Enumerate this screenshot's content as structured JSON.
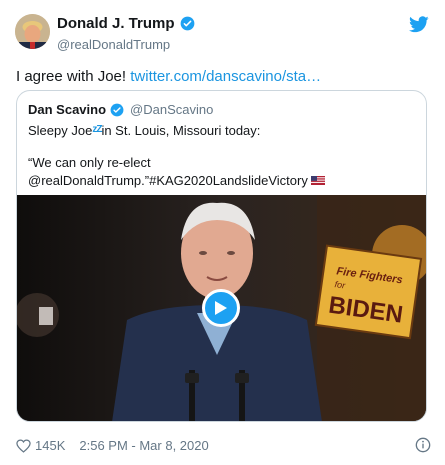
{
  "author": {
    "name": "Donald J. Trump",
    "handle": "@realDonaldTrump"
  },
  "tweet": {
    "text": "I agree with Joe! ",
    "link": "twitter.com/danscavino/sta…"
  },
  "quoted": {
    "name": "Dan Scavino",
    "handle": "@DanScavino",
    "line1_before": "Sleepy Joe",
    "zzz": "💤",
    "line1_after": "in St. Louis, Missouri today:",
    "line2": "“We can only re-elect",
    "line3": "@realDonaldTrump.”#KAG2020LandslideVictory"
  },
  "video": {
    "sign_line1": "Fire Fighters",
    "sign_line2": "for",
    "sign_line3": "BIDEN"
  },
  "footer": {
    "likes": "145K",
    "timestamp": "2:56 PM - Mar 8, 2020"
  },
  "colors": {
    "accent": "#1da1f2",
    "link": "#1b95e0",
    "muted": "#657786"
  },
  "icons": [
    "avatar",
    "verified-badge-icon",
    "twitter-bird-icon",
    "flag-us-icon",
    "play-icon",
    "heart-icon",
    "info-icon"
  ]
}
